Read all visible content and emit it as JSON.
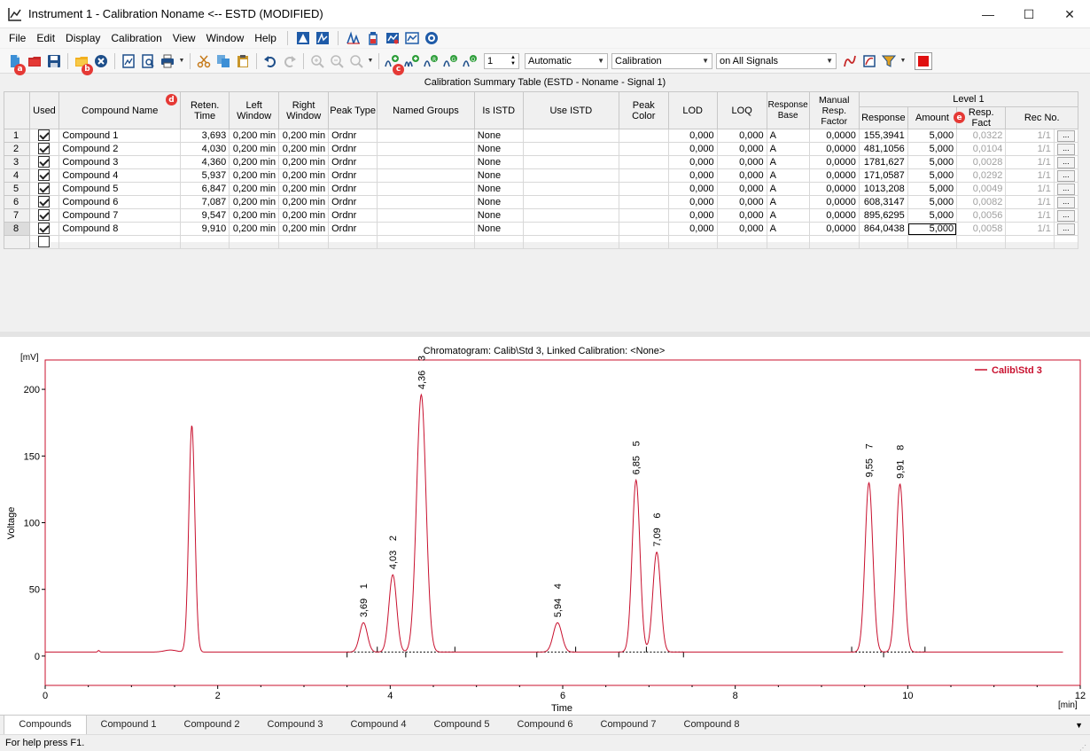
{
  "window": {
    "title": "Instrument 1 - Calibration Noname <-- ESTD (MODIFIED)",
    "minimize": "—",
    "maximize": "☐",
    "close": "✕"
  },
  "menu": [
    {
      "label": "File"
    },
    {
      "label": "Edit"
    },
    {
      "label": "Display"
    },
    {
      "label": "Calibration"
    },
    {
      "label": "View"
    },
    {
      "label": "Window"
    },
    {
      "label": "Help"
    }
  ],
  "toolbar": {
    "markers": {
      "a": "a",
      "b": "b",
      "c": "c",
      "d": "d",
      "e": "e"
    },
    "level_value": "1",
    "mode_combo": "Automatic",
    "type_combo": "Calibration",
    "signal_combo": "on All Signals"
  },
  "table": {
    "title": "Calibration Summary Table (ESTD - Noname - Signal 1)",
    "level_header": "Level 1",
    "headers": {
      "used": "Used",
      "name": "Compound Name",
      "ret": "Reten. Time",
      "left": "Left Window",
      "right": "Right Window",
      "peaktype": "Peak Type",
      "groups": "Named Groups",
      "isistd": "Is ISTD",
      "useistd": "Use ISTD",
      "color": "Peak Color",
      "lod": "LOD",
      "loq": "LOQ",
      "respbase": "Response Base",
      "manual": "Manual Resp. Factor",
      "response": "Response",
      "amount": "Amount",
      "respfact": "Resp. Fact",
      "recno": "Rec No."
    },
    "rows": [
      {
        "n": "1",
        "name": "Compound 1",
        "ret": "3,693",
        "left": "0,200 min",
        "right": "0,200 min",
        "peaktype": "Ordnr",
        "isistd": "None",
        "lod": "0,000",
        "loq": "0,000",
        "base": "A",
        "manual": "0,0000",
        "response": "155,3941",
        "amount": "5,000",
        "respfact": "0,0322",
        "recno": "1/1",
        "btn": "..."
      },
      {
        "n": "2",
        "name": "Compound 2",
        "ret": "4,030",
        "left": "0,200 min",
        "right": "0,200 min",
        "peaktype": "Ordnr",
        "isistd": "None",
        "lod": "0,000",
        "loq": "0,000",
        "base": "A",
        "manual": "0,0000",
        "response": "481,1056",
        "amount": "5,000",
        "respfact": "0,0104",
        "recno": "1/1",
        "btn": "..."
      },
      {
        "n": "3",
        "name": "Compound 3",
        "ret": "4,360",
        "left": "0,200 min",
        "right": "0,200 min",
        "peaktype": "Ordnr",
        "isistd": "None",
        "lod": "0,000",
        "loq": "0,000",
        "base": "A",
        "manual": "0,0000",
        "response": "1781,627",
        "amount": "5,000",
        "respfact": "0,0028",
        "recno": "1/1",
        "btn": "..."
      },
      {
        "n": "4",
        "name": "Compound 4",
        "ret": "5,937",
        "left": "0,200 min",
        "right": "0,200 min",
        "peaktype": "Ordnr",
        "isistd": "None",
        "lod": "0,000",
        "loq": "0,000",
        "base": "A",
        "manual": "0,0000",
        "response": "171,0587",
        "amount": "5,000",
        "respfact": "0,0292",
        "recno": "1/1",
        "btn": "..."
      },
      {
        "n": "5",
        "name": "Compound 5",
        "ret": "6,847",
        "left": "0,200 min",
        "right": "0,200 min",
        "peaktype": "Ordnr",
        "isistd": "None",
        "lod": "0,000",
        "loq": "0,000",
        "base": "A",
        "manual": "0,0000",
        "response": "1013,208",
        "amount": "5,000",
        "respfact": "0,0049",
        "recno": "1/1",
        "btn": "..."
      },
      {
        "n": "6",
        "name": "Compound 6",
        "ret": "7,087",
        "left": "0,200 min",
        "right": "0,200 min",
        "peaktype": "Ordnr",
        "isistd": "None",
        "lod": "0,000",
        "loq": "0,000",
        "base": "A",
        "manual": "0,0000",
        "response": "608,3147",
        "amount": "5,000",
        "respfact": "0,0082",
        "recno": "1/1",
        "btn": "..."
      },
      {
        "n": "7",
        "name": "Compound 7",
        "ret": "9,547",
        "left": "0,200 min",
        "right": "0,200 min",
        "peaktype": "Ordnr",
        "isistd": "None",
        "lod": "0,000",
        "loq": "0,000",
        "base": "A",
        "manual": "0,0000",
        "response": "895,6295",
        "amount": "5,000",
        "respfact": "0,0056",
        "recno": "1/1",
        "btn": "..."
      },
      {
        "n": "8",
        "name": "Compound 8",
        "ret": "9,910",
        "left": "0,200 min",
        "right": "0,200 min",
        "peaktype": "Ordnr",
        "isistd": "None",
        "lod": "0,000",
        "loq": "0,000",
        "base": "A",
        "manual": "0,0000",
        "response": "864,0438",
        "amount": "5,000",
        "respfact": "0,0058",
        "recno": "1/1",
        "btn": "..."
      }
    ]
  },
  "chart_data": {
    "type": "line",
    "title": "Chromatogram: Calib\\Std 3, Linked Calibration: <None>",
    "xlabel": "Time",
    "ylabel": "Voltage",
    "x_unit": "[min]",
    "y_unit": "[mV]",
    "xlim": [
      0,
      12
    ],
    "ylim": [
      -22,
      222
    ],
    "xticks": [
      0,
      2,
      4,
      6,
      8,
      10,
      12
    ],
    "yticks": [
      0,
      50,
      100,
      150,
      200
    ],
    "legend": {
      "position": "top-right"
    },
    "color": "#c8102e",
    "series": [
      {
        "name": "Calib\\Std 3"
      }
    ],
    "baseline": 3,
    "peaks": [
      {
        "rt": 1.7,
        "height": 170,
        "width": 0.035,
        "label": "",
        "num": ""
      },
      {
        "rt": 3.69,
        "height": 22,
        "width": 0.045,
        "label": "3,69",
        "num": "1"
      },
      {
        "rt": 4.03,
        "height": 58,
        "width": 0.045,
        "label": "4,03",
        "num": "2"
      },
      {
        "rt": 4.36,
        "height": 193,
        "width": 0.055,
        "label": "4,36",
        "num": "3"
      },
      {
        "rt": 5.94,
        "height": 22,
        "width": 0.05,
        "label": "5,94",
        "num": "4"
      },
      {
        "rt": 6.85,
        "height": 129,
        "width": 0.045,
        "label": "6,85",
        "num": "5"
      },
      {
        "rt": 7.09,
        "height": 75,
        "width": 0.045,
        "label": "7,09",
        "num": "6"
      },
      {
        "rt": 9.55,
        "height": 127,
        "width": 0.045,
        "label": "9,55",
        "num": "7"
      },
      {
        "rt": 9.91,
        "height": 126,
        "width": 0.045,
        "label": "9,91",
        "num": "8"
      }
    ],
    "integration_segments": [
      [
        3.5,
        3.85
      ],
      [
        3.85,
        4.18
      ],
      [
        4.18,
        4.75
      ],
      [
        5.7,
        6.15
      ],
      [
        6.65,
        6.97
      ],
      [
        6.97,
        7.4
      ],
      [
        9.35,
        9.72
      ],
      [
        9.72,
        10.2
      ]
    ]
  },
  "tabs": [
    {
      "label": "Compounds",
      "active": true
    },
    {
      "label": "Compound 1"
    },
    {
      "label": "Compound 2"
    },
    {
      "label": "Compound 3"
    },
    {
      "label": "Compound 4"
    },
    {
      "label": "Compound 5"
    },
    {
      "label": "Compound 6"
    },
    {
      "label": "Compound 7"
    },
    {
      "label": "Compound 8"
    }
  ],
  "status": {
    "text": "For help press F1."
  }
}
